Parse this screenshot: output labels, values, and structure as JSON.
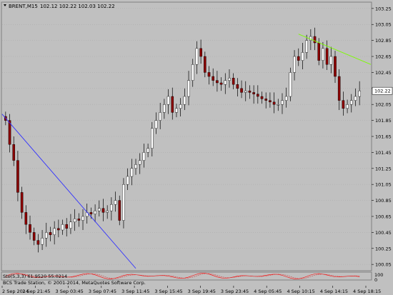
{
  "chart_data": {
    "type": "candlestick",
    "symbol_label": "BRENT,M15",
    "ohlc_readout": "102.12 102.22 102.03 102.22",
    "current_price": "102.22",
    "y_ticks": [
      "103.25",
      "103.05",
      "102.85",
      "102.65",
      "102.45",
      "102.25",
      "102.05",
      "101.85",
      "101.65",
      "101.45",
      "101.25",
      "101.05",
      "100.85",
      "100.65",
      "100.45",
      "100.25",
      "100.05"
    ],
    "ylim": [
      99.98,
      103.32
    ],
    "x_ticks": [
      "2 Sep 2014",
      "2 Sep 21:45",
      "3 Sep 03:45",
      "3 Sep 07:45",
      "3 Sep 11:45",
      "3 Sep 15:45",
      "3 Sep 19:45",
      "3 Sep 23:45",
      "4 Sep 05:45",
      "4 Sep 10:15",
      "4 Sep 14:15",
      "4 Sep 18:15"
    ],
    "close_series": [
      101.85,
      101.55,
      101.35,
      100.95,
      100.7,
      100.55,
      100.45,
      100.35,
      100.3,
      100.38,
      100.45,
      100.42,
      100.5,
      100.48,
      100.55,
      100.5,
      100.58,
      100.62,
      100.6,
      100.65,
      100.7,
      100.68,
      100.72,
      100.75,
      100.7,
      100.72,
      100.8,
      100.85,
      100.6,
      101.05,
      101.15,
      101.25,
      101.3,
      101.35,
      101.45,
      101.5,
      101.75,
      101.85,
      101.95,
      102.05,
      102.15,
      101.95,
      102.0,
      102.05,
      102.15,
      102.35,
      102.55,
      102.75,
      102.65,
      102.45,
      102.4,
      102.35,
      102.32,
      102.3,
      102.35,
      102.38,
      102.3,
      102.25,
      102.2,
      102.22,
      102.2,
      102.18,
      102.15,
      102.12,
      102.1,
      102.08,
      102.05,
      102.05,
      102.1,
      102.15,
      102.45,
      102.65,
      102.6,
      102.7,
      102.85,
      102.9,
      102.82,
      102.6,
      102.75,
      102.55,
      102.65,
      102.4,
      102.1,
      102.0,
      102.05,
      102.1,
      102.15,
      102.22
    ],
    "trendlines": [
      {
        "color": "#3030ff",
        "from": {
          "bar": 0,
          "price": 101.93
        },
        "to": {
          "bar": 32,
          "price": 100.0
        }
      },
      {
        "color": "#7cfc00",
        "from": {
          "bar": 72,
          "price": 102.93
        },
        "to": {
          "bar": 86,
          "price": 102.55
        }
      }
    ],
    "indicator": {
      "label": "Sto(5,3,3) 61.9520 55.0214",
      "scale_top": "100",
      "scale_bottom": "0",
      "main_color": "#ff0000",
      "signal_color": "#d04040"
    }
  },
  "footer": {
    "copyright": "BCS Trade Station, © 2001-2014, MetaQuotes Software Corp."
  },
  "colors": {
    "background": "#c0c0c0",
    "bull": "#ffffff",
    "bear": "#8b0000",
    "grid": "#a8a8a8",
    "price_tag_bg": "#ffffff"
  }
}
